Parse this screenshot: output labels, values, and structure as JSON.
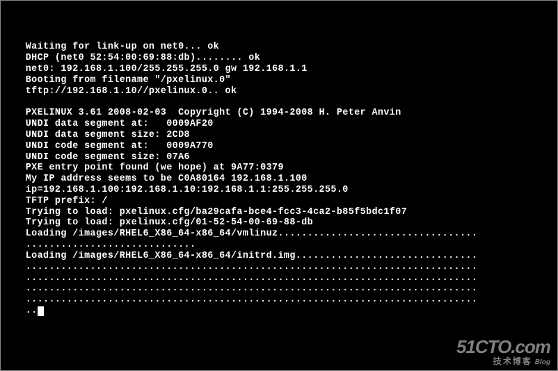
{
  "console": {
    "lines": [
      "",
      "",
      "",
      "    Waiting for link-up on net0... ok",
      "    DHCP (net0 52:54:00:69:88:db)........ ok",
      "    net0: 192.168.1.100/255.255.255.0 gw 192.168.1.1",
      "    Booting from filename \"/pxelinux.0\"",
      "    tftp://192.168.1.10//pxelinux.0.. ok",
      "",
      "    PXELINUX 3.61 2008-02-03  Copyright (C) 1994-2008 H. Peter Anvin",
      "    UNDI data segment at:   0009AF20",
      "    UNDI data segment size: 2CD8",
      "    UNDI code segment at:   0009A770",
      "    UNDI code segment size: 07A6",
      "    PXE entry point found (we hope) at 9A77:0379",
      "    My IP address seems to be C0A80164 192.168.1.100",
      "    ip=192.168.1.100:192.168.1.10:192.168.1.1:255.255.255.0",
      "    TFTP prefix: /",
      "    Trying to load: pxelinux.cfg/ba29cafa-bce4-fcc3-4ca2-b85f5bdc1f07",
      "    Trying to load: pxelinux.cfg/01-52-54-00-69-88-db",
      "    Loading /images/RHEL6_X86_64-x86_64/vmlinuz..................................",
      "    .............................",
      "    Loading /images/RHEL6_X86_64-x86_64/initrd.img...............................",
      "    .............................................................................",
      "    .............................................................................",
      "    .............................................................................",
      "    .............................................................................",
      "    .."
    ]
  },
  "watermark": {
    "brand": "51CTO.com",
    "sub": "技术博客",
    "blog_tag": "Blog"
  }
}
